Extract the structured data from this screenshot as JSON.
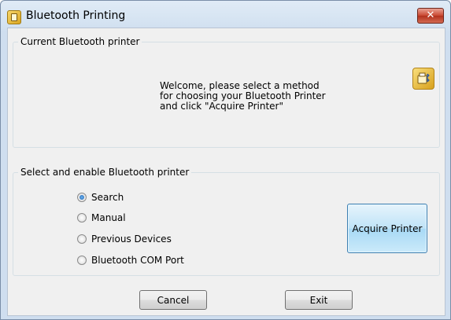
{
  "window": {
    "title": "Bluetooth Printing",
    "close_label": "✕"
  },
  "current_group": {
    "label": "Current Bluetooth printer",
    "welcome_lines": [
      "Welcome, please select a method",
      "for choosing your Bluetooth Printer",
      "and click \"Acquire Printer\""
    ]
  },
  "select_group": {
    "label": "Select and enable Bluetooth printer",
    "options": [
      {
        "label": "Search",
        "selected": true
      },
      {
        "label": "Manual",
        "selected": false
      },
      {
        "label": "Previous Devices",
        "selected": false
      },
      {
        "label": "Bluetooth COM Port",
        "selected": false
      }
    ],
    "acquire_label": "Acquire Printer"
  },
  "buttons": {
    "cancel": "Cancel",
    "exit": "Exit"
  }
}
